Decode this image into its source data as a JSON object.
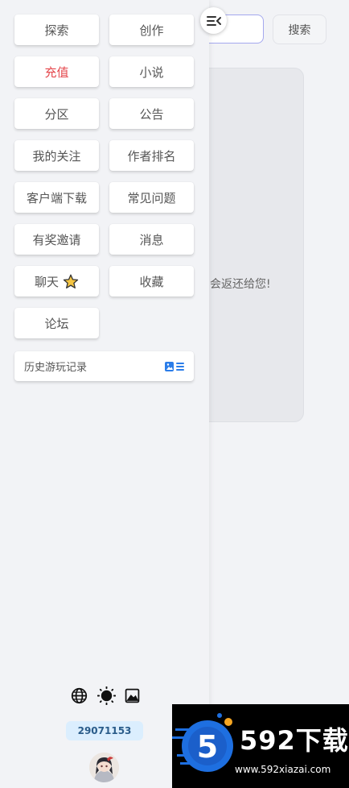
{
  "header": {
    "search_button": "搜索"
  },
  "background": {
    "card_text": "会返还给您!"
  },
  "drawer": {
    "nav": [
      {
        "label": "探索",
        "name": "nav-explore",
        "highlight": false
      },
      {
        "label": "创作",
        "name": "nav-create",
        "highlight": false
      },
      {
        "label": "充值",
        "name": "nav-recharge",
        "highlight": true
      },
      {
        "label": "小说",
        "name": "nav-novel",
        "highlight": false
      },
      {
        "label": "分区",
        "name": "nav-sections",
        "highlight": false
      },
      {
        "label": "公告",
        "name": "nav-announcements",
        "highlight": false
      },
      {
        "label": "我的关注",
        "name": "nav-following",
        "highlight": false
      },
      {
        "label": "作者排名",
        "name": "nav-author-ranking",
        "highlight": false
      },
      {
        "label": "客户端下载",
        "name": "nav-client-download",
        "highlight": false
      },
      {
        "label": "常见问题",
        "name": "nav-faq",
        "highlight": false
      },
      {
        "label": "有奖邀请",
        "name": "nav-invite",
        "highlight": false
      },
      {
        "label": "消息",
        "name": "nav-messages",
        "highlight": false
      },
      {
        "label": "聊天",
        "name": "nav-chat",
        "highlight": false,
        "icon": "star-icon"
      },
      {
        "label": "收藏",
        "name": "nav-favorites",
        "highlight": false
      },
      {
        "label": "论坛",
        "name": "nav-forum",
        "highlight": false
      }
    ],
    "history": {
      "label": "历史游玩记录",
      "icon": "card-list-icon"
    },
    "bottom_icons": [
      "globe-icon",
      "sun-icon",
      "image-icon"
    ],
    "user_id": "29071153"
  },
  "colors": {
    "accent_red": "#e5484d",
    "accent_blue": "#2b7de9",
    "star": "#f5c542"
  },
  "watermark": {
    "logo_text": "592下载",
    "url": "www.592xiazai.com",
    "logo_number": "5"
  }
}
